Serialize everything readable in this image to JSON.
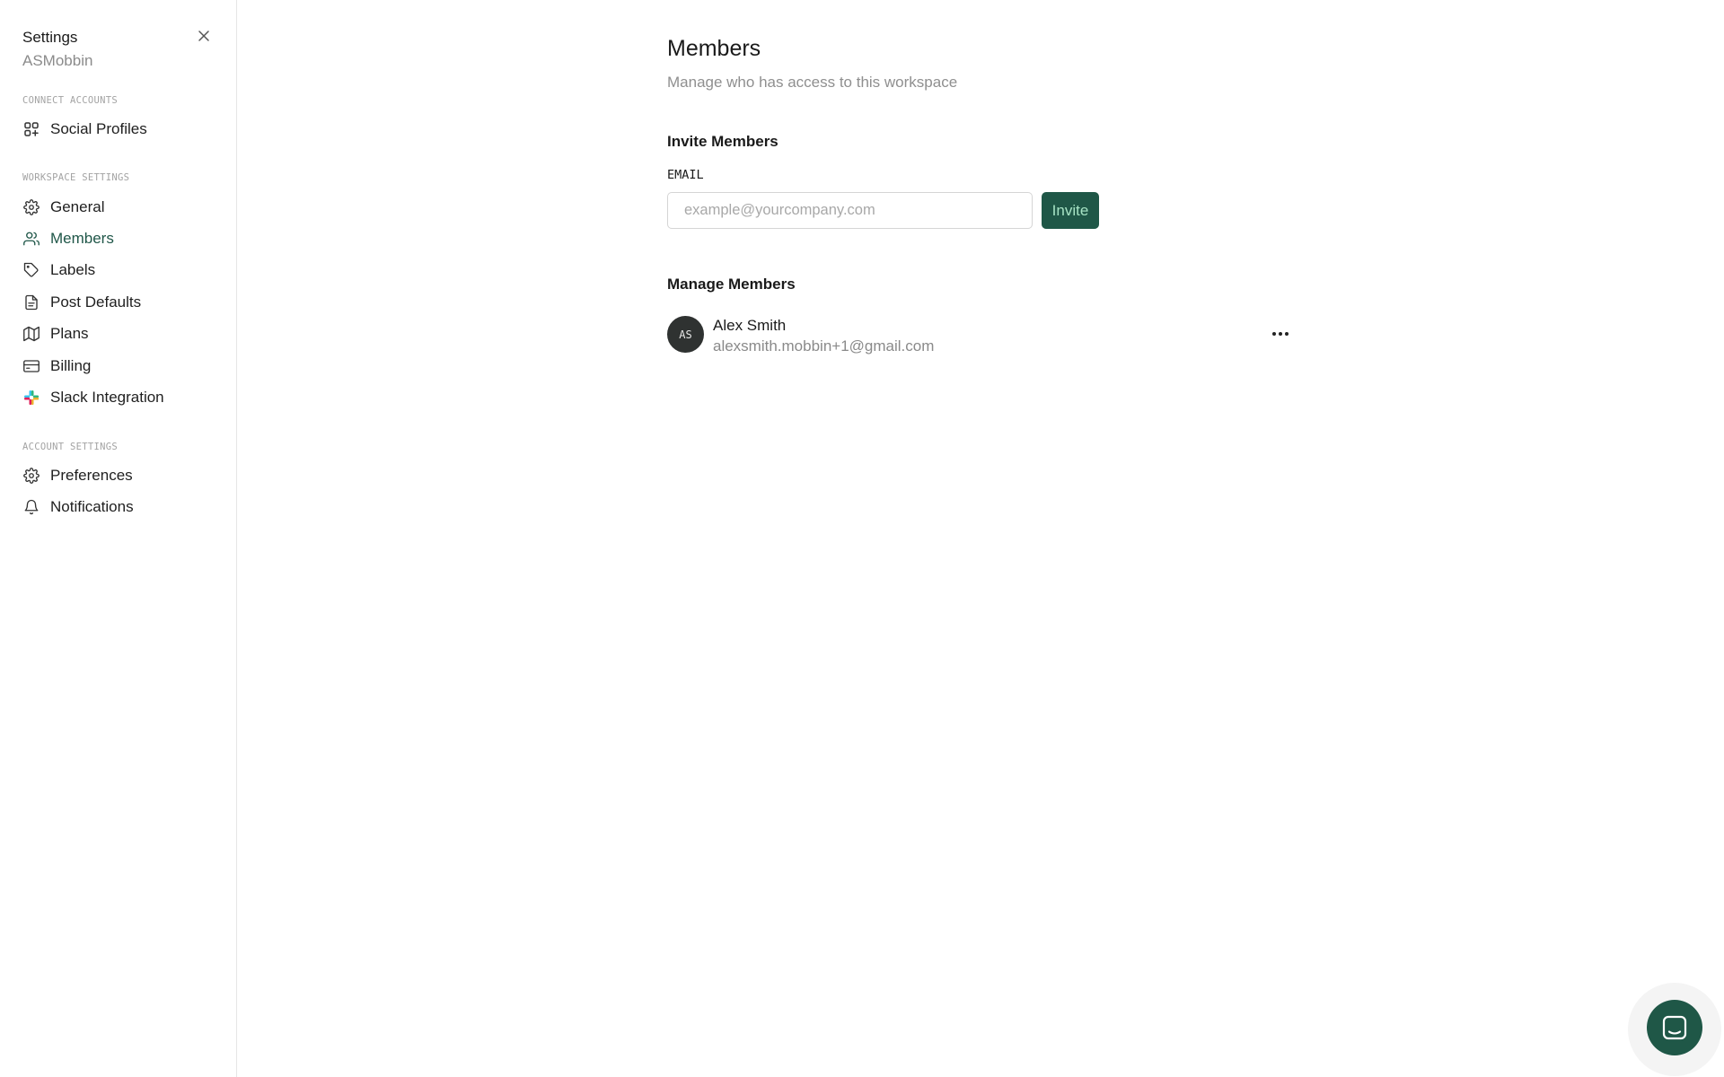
{
  "sidebar": {
    "title": "Settings",
    "workspace": "ASMobbin",
    "sections": {
      "connect": "CONNECT ACCOUNTS",
      "workspace": "WORKSPACE SETTINGS",
      "account": "ACCOUNT SETTINGS"
    },
    "items": [
      {
        "label": "Social Profiles",
        "icon": "apps-icon"
      },
      {
        "label": "General",
        "icon": "gear-icon"
      },
      {
        "label": "Members",
        "icon": "users-icon",
        "active": true
      },
      {
        "label": "Labels",
        "icon": "tag-icon"
      },
      {
        "label": "Post Defaults",
        "icon": "document-icon"
      },
      {
        "label": "Plans",
        "icon": "map-icon"
      },
      {
        "label": "Billing",
        "icon": "credit-card-icon"
      },
      {
        "label": "Slack Integration",
        "icon": "slack-icon"
      },
      {
        "label": "Preferences",
        "icon": "gear-icon"
      },
      {
        "label": "Notifications",
        "icon": "bell-icon"
      }
    ]
  },
  "main": {
    "title": "Members",
    "subtitle": "Manage who has access to this workspace",
    "invite": {
      "heading": "Invite Members",
      "email_label": "EMAIL",
      "email_value": "",
      "email_placeholder": "example@yourcompany.com",
      "button_label": "Invite"
    },
    "manage": {
      "heading": "Manage Members",
      "members": [
        {
          "initials": "AS",
          "name": "Alex Smith",
          "email": "alexsmith.mobbin+1@gmail.com"
        }
      ]
    }
  },
  "colors": {
    "accent": "#1f5747",
    "active_nav": "#205749",
    "muted_text": "#8f8f8f"
  }
}
